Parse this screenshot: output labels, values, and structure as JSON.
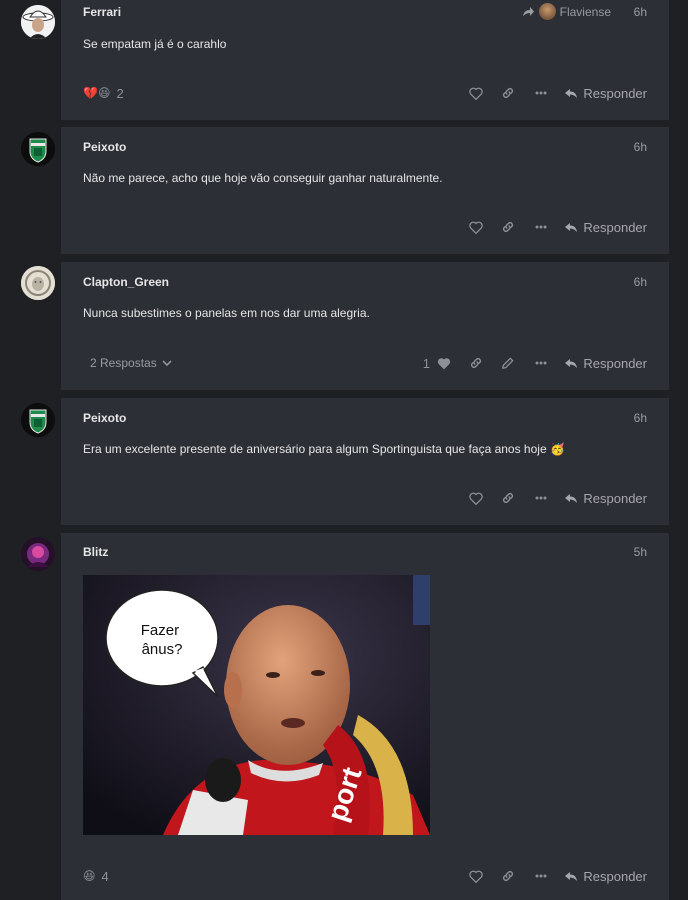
{
  "reply_label": "Responder",
  "posts": [
    {
      "author": "Ferrari",
      "time": "6h",
      "text": "Se empatam já é o carahlo",
      "reply_to": "Flaviense",
      "reactions": {
        "emojis": "💔😆",
        "count": "2"
      }
    },
    {
      "author": "Peixoto",
      "time": "6h",
      "text": "Não me parece, acho que hoje vão conseguir ganhar naturalmente."
    },
    {
      "author": "Clapton_Green",
      "time": "6h",
      "text": "Nunca subestimes o panelas em nos dar uma alegria.",
      "replies_label": "2 Respostas",
      "like_count": "1"
    },
    {
      "author": "Peixoto",
      "time": "6h",
      "text": "Era um excelente presente de aniversário para algum Sportinguista que faça anos hoje 🥳"
    },
    {
      "author": "Blitz",
      "time": "5h",
      "meme_caption": "Fazer ânus?",
      "meme_caption_lines": [
        "Fazer",
        "ânus?"
      ],
      "scarf_text": "port",
      "reactions": {
        "emojis": "😆",
        "count": "4"
      }
    }
  ],
  "colors": {
    "page_bg": "#1f2024",
    "card_bg": "#2d2f36",
    "text": "#e6e6e6",
    "muted": "#9a9ca3"
  },
  "icons": [
    "reply-arrow-icon",
    "heart-icon",
    "link-icon",
    "more-icon",
    "pencil-icon",
    "chevron-down-icon",
    "share-arrow-icon"
  ]
}
